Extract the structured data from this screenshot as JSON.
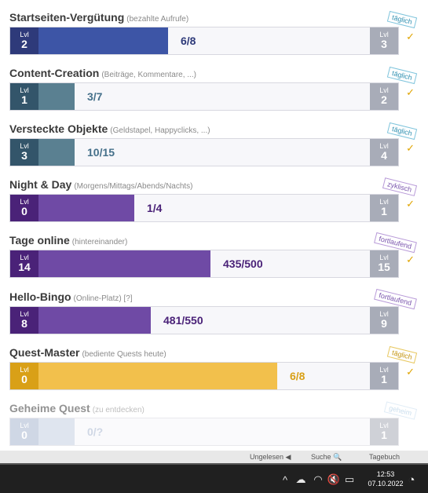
{
  "quests": [
    {
      "name": "Startseiten-Vergütung",
      "subtitle": "(bezahlte Aufrufe)",
      "level_label": "Lvl",
      "level": "2",
      "next_level_label": "Lvl",
      "next_level": "3",
      "progress_text": "6/8",
      "progress_fraction": 0.39,
      "badge": "täglich",
      "badge_check": "✓",
      "colors": {
        "level_bg": "#2e3a7a",
        "fill": "#3d55a6",
        "progress_text": "#2e3a7a",
        "badge_border": "#7fc4dc",
        "badge_text": "#2e8fb0"
      }
    },
    {
      "name": "Content-Creation",
      "subtitle": "(Beiträge, Kommentare, ...)",
      "level_label": "Lvl",
      "level": "1",
      "next_level_label": "Lvl",
      "next_level": "2",
      "progress_text": "3/7",
      "progress_fraction": 0.11,
      "badge": "täglich",
      "badge_check": "✓",
      "colors": {
        "level_bg": "#33556a",
        "fill": "#5a8091",
        "progress_text": "#45708a",
        "badge_border": "#7fc4dc",
        "badge_text": "#2e8fb0"
      }
    },
    {
      "name": "Versteckte Objekte",
      "subtitle": "(Geldstapel, Happyclicks, ...)",
      "level_label": "Lvl",
      "level": "3",
      "next_level_label": "Lvl",
      "next_level": "4",
      "progress_text": "10/15",
      "progress_fraction": 0.11,
      "badge": "täglich",
      "badge_check": "✓",
      "colors": {
        "level_bg": "#33556a",
        "fill": "#5a8091",
        "progress_text": "#45708a",
        "badge_border": "#7fc4dc",
        "badge_text": "#2e8fb0"
      }
    },
    {
      "name": "Night & Day",
      "subtitle": "(Morgens/Mittags/Abends/Nachts)",
      "level_label": "Lvl",
      "level": "0",
      "next_level_label": "Lvl",
      "next_level": "1",
      "progress_text": "1/4",
      "progress_fraction": 0.29,
      "badge": "zyklisch",
      "badge_check": "✓",
      "colors": {
        "level_bg": "#4a2278",
        "fill": "#6f4aa5",
        "progress_text": "#4a2278",
        "badge_border": "#b89ad8",
        "badge_text": "#7a55ad"
      }
    },
    {
      "name": "Tage online",
      "subtitle": "(hintereinander)",
      "level_label": "Lvl",
      "level": "14",
      "next_level_label": "Lvl",
      "next_level": "15",
      "progress_text": "435/500",
      "progress_fraction": 0.52,
      "badge": "fortlaufend",
      "badge_check": "✓",
      "colors": {
        "level_bg": "#4a2278",
        "fill": "#6f4aa5",
        "progress_text": "#4a2278",
        "badge_border": "#b89ad8",
        "badge_text": "#7a55ad"
      }
    },
    {
      "name": "Hello-Bingo",
      "subtitle": "(Online-Platz) [?]",
      "level_label": "Lvl",
      "level": "8",
      "next_level_label": "Lvl",
      "next_level": "9",
      "progress_text": "481/550",
      "progress_fraction": 0.34,
      "badge": "fortlaufend",
      "badge_check": "",
      "colors": {
        "level_bg": "#4a2278",
        "fill": "#6f4aa5",
        "progress_text": "#4a2278",
        "badge_border": "#b89ad8",
        "badge_text": "#7a55ad"
      }
    },
    {
      "name": "Quest-Master",
      "subtitle": "(bediente Quests heute)",
      "level_label": "Lvl",
      "level": "0",
      "next_level_label": "Lvl",
      "next_level": "1",
      "progress_text": "6/8",
      "progress_fraction": 0.72,
      "badge": "täglich",
      "badge_check": "✓",
      "colors": {
        "level_bg": "#d9a017",
        "fill": "#f2c04c",
        "progress_text": "#d9a017",
        "badge_border": "#e8c860",
        "badge_text": "#c49410"
      }
    },
    {
      "name": "Geheime Quest",
      "subtitle": "(zu entdecken)",
      "level_label": "Lvl",
      "level": "0",
      "next_level_label": "Lvl",
      "next_level": "1",
      "progress_text": "0/?",
      "progress_fraction": 0.11,
      "badge": "geheim",
      "badge_check": "",
      "faded": true,
      "colors": {
        "level_bg": "#a9b8d0",
        "fill": "#c6d1e2",
        "progress_text": "#a9b8d0",
        "badge_border": "#c8def0",
        "badge_text": "#a0c4e0"
      }
    }
  ],
  "overlay": {
    "left_text": "Ungelesen ◀",
    "middle_text": "Suche 🔍",
    "right_text": "Tagebuch"
  },
  "taskbar": {
    "tray_icons": [
      "chevron-up-icon",
      "cloud-icon",
      "wifi-icon",
      "speaker-muted-icon",
      "battery-icon"
    ],
    "time": "12:53",
    "date": "07.10.2022"
  }
}
